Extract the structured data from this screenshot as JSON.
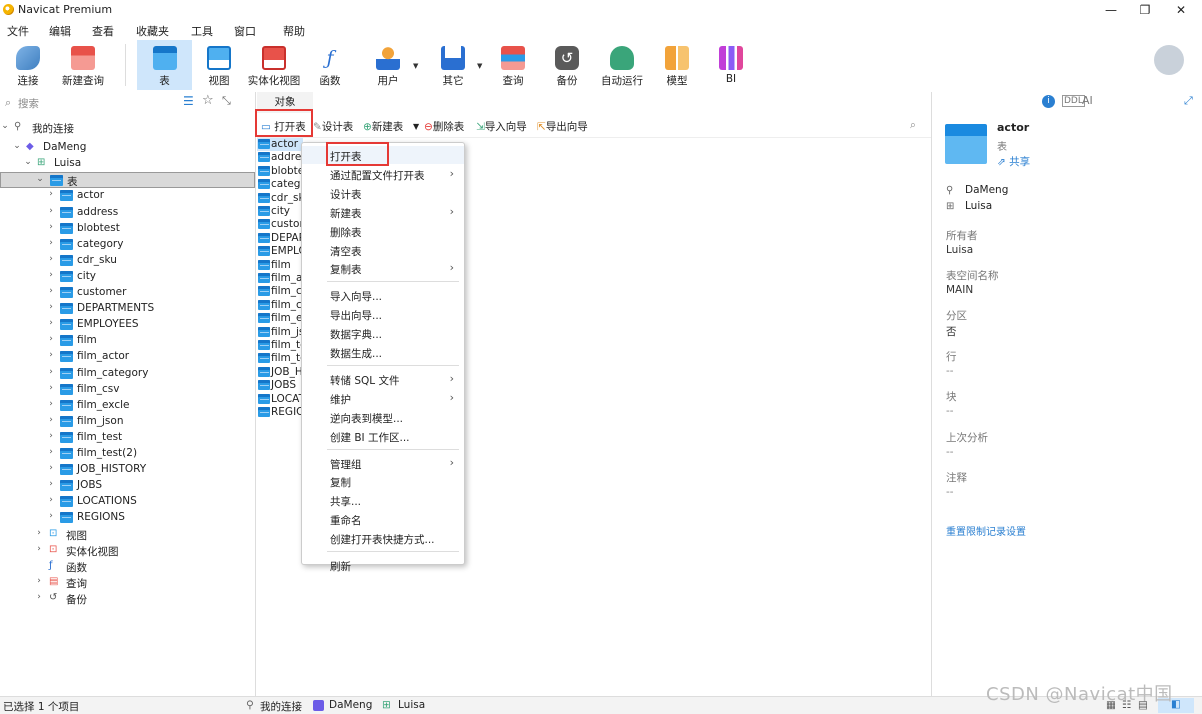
{
  "window": {
    "title": "Navicat Premium",
    "min": "—",
    "max": "❐",
    "close": "✕"
  },
  "menu": [
    "文件",
    "编辑",
    "查看",
    "收藏夹",
    "工具",
    "窗口",
    "帮助"
  ],
  "toolbar": [
    {
      "label": "连接",
      "icon": "plug-icon",
      "color": "#5b9bd5"
    },
    {
      "label": "新建查询",
      "icon": "new-query-icon",
      "color": "#e8524a"
    },
    {
      "label": "表",
      "icon": "table-icon",
      "color": "#2a9be6"
    },
    {
      "label": "视图",
      "icon": "view-icon",
      "color": "#2a9be6"
    },
    {
      "label": "实体化视图",
      "icon": "materialized-view-icon",
      "color": "#e8524a"
    },
    {
      "label": "函数",
      "icon": "function-icon",
      "color": "#2a6fd1"
    },
    {
      "label": "用户",
      "icon": "user-icon",
      "color": "#f2a33a"
    },
    {
      "label": "其它",
      "icon": "tools-icon",
      "color": "#2a6fd1"
    },
    {
      "label": "查询",
      "icon": "query-icon",
      "color": "#e8524a"
    },
    {
      "label": "备份",
      "icon": "backup-icon",
      "color": "#555555"
    },
    {
      "label": "自动运行",
      "icon": "robot-icon",
      "color": "#3aa57a"
    },
    {
      "label": "模型",
      "icon": "model-icon",
      "color": "#f2a33a"
    },
    {
      "label": "BI",
      "icon": "bi-icon",
      "color": "#c13fd8"
    }
  ],
  "left": {
    "search_placeholder": "搜索",
    "my_connections": "我的连接",
    "connection": "DaMeng",
    "schema": "Luisa",
    "tables_node": "表",
    "tables": [
      "actor",
      "address",
      "blobtest",
      "category",
      "cdr_sku",
      "city",
      "customer",
      "DEPARTMENTS",
      "EMPLOYEES",
      "film",
      "film_actor",
      "film_category",
      "film_csv",
      "film_excle",
      "film_json",
      "film_test",
      "film_test(2)",
      "JOB_HISTORY",
      "JOBS",
      "LOCATIONS",
      "REGIONS"
    ],
    "other_nodes": [
      "视图",
      "实体化视图",
      "函数",
      "查询",
      "备份"
    ]
  },
  "middle": {
    "tab": "对象",
    "buttons": {
      "open": "打开表",
      "design": "设计表",
      "new": "新建表",
      "delete": "删除表",
      "import": "导入向导",
      "export": "导出向导"
    },
    "list": [
      "actor",
      "addres",
      "blobte",
      "catego",
      "cdr_sk",
      "city",
      "custon",
      "DEPAR",
      "EMPLO",
      "film",
      "film_ac",
      "film_ca",
      "film_cs",
      "film_ex",
      "film_js",
      "film_te",
      "film_te",
      "JOB_H",
      "JOBS",
      "LOCAT",
      "REGIO"
    ]
  },
  "context_menu": {
    "groups": [
      [
        {
          "label": "打开表",
          "sub": false
        },
        {
          "label": "通过配置文件打开表",
          "sub": true
        },
        {
          "label": "设计表",
          "sub": false
        },
        {
          "label": "新建表",
          "sub": true
        },
        {
          "label": "删除表",
          "sub": false
        },
        {
          "label": "清空表",
          "sub": false
        },
        {
          "label": "复制表",
          "sub": true
        }
      ],
      [
        {
          "label": "导入向导...",
          "sub": false
        },
        {
          "label": "导出向导...",
          "sub": false
        },
        {
          "label": "数据字典...",
          "sub": false
        },
        {
          "label": "数据生成...",
          "sub": false
        }
      ],
      [
        {
          "label": "转储 SQL 文件",
          "sub": true
        },
        {
          "label": "维护",
          "sub": true
        },
        {
          "label": "逆向表到模型...",
          "sub": false
        },
        {
          "label": "创建 BI 工作区...",
          "sub": false
        }
      ],
      [
        {
          "label": "管理组",
          "sub": true
        },
        {
          "label": "复制",
          "sub": false
        },
        {
          "label": "共享...",
          "sub": false
        },
        {
          "label": "重命名",
          "sub": false
        },
        {
          "label": "创建打开表快捷方式...",
          "sub": false
        }
      ],
      [
        {
          "label": "刷新",
          "sub": false
        }
      ]
    ]
  },
  "right": {
    "name": "actor",
    "type": "表",
    "share": "共享",
    "connection": "DaMeng",
    "schema": "Luisa",
    "owner_label": "所有者",
    "owner": "Luisa",
    "tablespace_label": "表空间名称",
    "tablespace": "MAIN",
    "partition_label": "分区",
    "partition": "否",
    "rows_label": "行",
    "rows": "--",
    "blocks_label": "块",
    "blocks": "--",
    "last_analyzed_label": "上次分析",
    "last_analyzed": "--",
    "comment_label": "注释",
    "comment": "--",
    "reset_link": "重置限制记录设置"
  },
  "status": {
    "selected": "已选择 1 个项目",
    "crumb1": "我的连接",
    "crumb2": "DaMeng",
    "crumb3": "Luisa"
  },
  "watermark": "CSDN @Navicat中国"
}
